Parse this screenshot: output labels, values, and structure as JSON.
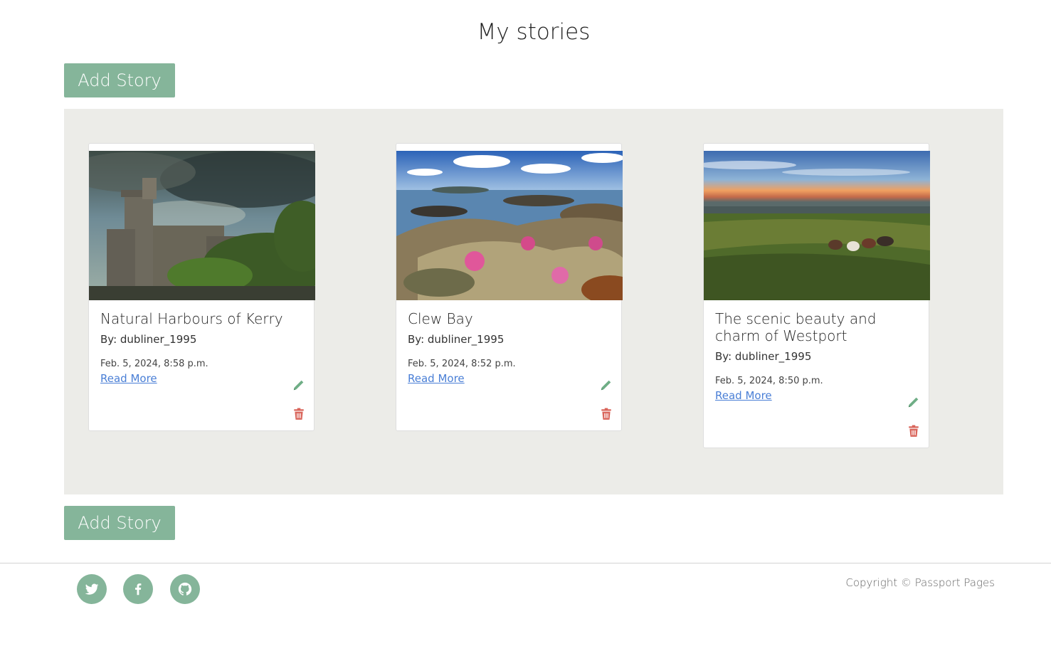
{
  "page": {
    "title": "My stories",
    "add_story_label": "Add Story"
  },
  "stories": [
    {
      "title": "Natural Harbours of Kerry",
      "author": "By: dubliner_1995",
      "date": "Feb. 5, 2024, 8:58 p.m.",
      "read_more": "Read More",
      "image": "castle-photo"
    },
    {
      "title": "Clew Bay",
      "author": "By: dubliner_1995",
      "date": "Feb. 5, 2024, 8:52 p.m.",
      "read_more": "Read More",
      "image": "coast-photo"
    },
    {
      "title": "The scenic beauty and charm of Westport",
      "author": "By: dubliner_1995",
      "date": "Feb. 5, 2024, 8:50 p.m.",
      "read_more": "Read More",
      "image": "field-sunset-photo"
    }
  ],
  "footer": {
    "social": [
      "twitter-icon",
      "facebook-icon",
      "github-icon"
    ],
    "copyright": "Copyright © Passport Pages"
  },
  "colors": {
    "accent": "#85b59a",
    "panel": "#ecece8",
    "link": "#4a7fd6",
    "edit": "#6fae86",
    "delete": "#d9645a"
  }
}
